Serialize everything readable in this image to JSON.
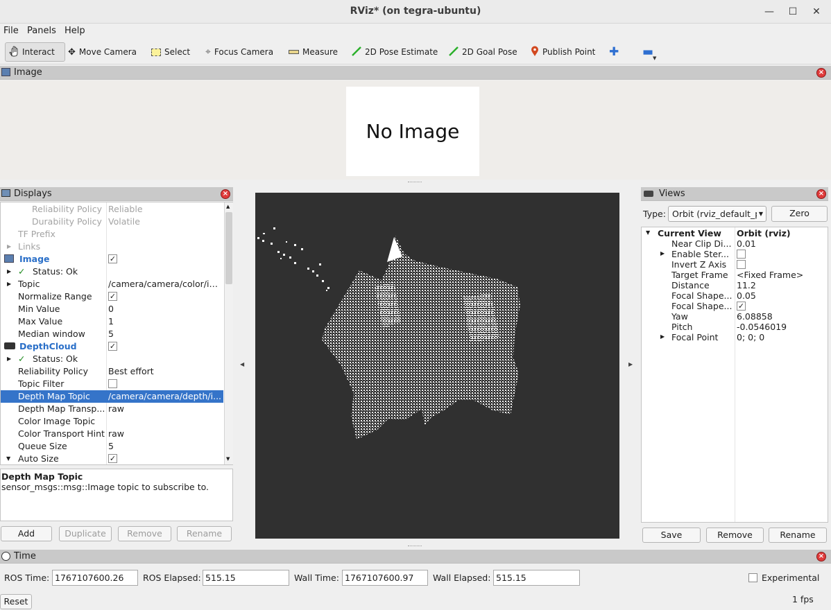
{
  "window": {
    "title": "RViz* (on tegra-ubuntu)"
  },
  "menu": [
    "File",
    "Panels",
    "Help"
  ],
  "toolbar": {
    "interact": "Interact",
    "move_camera": "Move Camera",
    "select": "Select",
    "focus_camera": "Focus Camera",
    "measure": "Measure",
    "pose_estimate": "2D Pose Estimate",
    "goal_pose": "2D Goal Pose",
    "publish_point": "Publish Point"
  },
  "image_panel": {
    "title": "Image",
    "placeholder": "No Image"
  },
  "displays": {
    "title": "Displays",
    "rows": [
      {
        "key": "Reliability Policy",
        "value": "Reliable"
      },
      {
        "key": "Durability Policy",
        "value": "Volatile"
      },
      {
        "key": "TF Prefix",
        "value": ""
      },
      {
        "key": "Links",
        "value": ""
      },
      {
        "key": "Image",
        "value": ""
      },
      {
        "key": "Status: Ok",
        "value": ""
      },
      {
        "key": "Topic",
        "value": "/camera/camera/color/im..."
      },
      {
        "key": "Normalize Range",
        "value": ""
      },
      {
        "key": "Min Value",
        "value": "0"
      },
      {
        "key": "Max Value",
        "value": "1"
      },
      {
        "key": "Median window",
        "value": "5"
      },
      {
        "key": "DepthCloud",
        "value": ""
      },
      {
        "key": "Status: Ok",
        "value": ""
      },
      {
        "key": "Reliability Policy",
        "value": "Best effort"
      },
      {
        "key": "Topic Filter",
        "value": ""
      },
      {
        "key": "Depth Map Topic",
        "value": "/camera/camera/depth/i..."
      },
      {
        "key": "Depth Map Transp...",
        "value": "raw"
      },
      {
        "key": "Color Image Topic",
        "value": ""
      },
      {
        "key": "Color Transport Hint",
        "value": "raw"
      },
      {
        "key": "Queue Size",
        "value": "5"
      },
      {
        "key": "Auto Size",
        "value": ""
      }
    ],
    "help_title": "Depth Map Topic",
    "help_text": "sensor_msgs::msg::Image topic to subscribe to.",
    "buttons": {
      "add": "Add",
      "duplicate": "Duplicate",
      "remove": "Remove",
      "rename": "Rename"
    }
  },
  "views": {
    "title": "Views",
    "type_label": "Type:",
    "type_value": "Orbit (rviz_default_p",
    "zero": "Zero",
    "rows": [
      {
        "key": "Current View",
        "value": "Orbit (rviz)"
      },
      {
        "key": "Near Clip Di...",
        "value": "0.01"
      },
      {
        "key": "Enable Ster...",
        "value": ""
      },
      {
        "key": "Invert Z Axis",
        "value": ""
      },
      {
        "key": "Target Frame",
        "value": "<Fixed Frame>"
      },
      {
        "key": "Distance",
        "value": "11.2"
      },
      {
        "key": "Focal Shape...",
        "value": "0.05"
      },
      {
        "key": "Focal Shape...",
        "value": ""
      },
      {
        "key": "Yaw",
        "value": "6.08858"
      },
      {
        "key": "Pitch",
        "value": "-0.0546019"
      },
      {
        "key": "Focal Point",
        "value": "0; 0; 0"
      }
    ],
    "buttons": {
      "save": "Save",
      "remove": "Remove",
      "rename": "Rename"
    }
  },
  "time": {
    "title": "Time",
    "ros_time_label": "ROS Time:",
    "ros_time": "1767107600.26",
    "ros_elapsed_label": "ROS Elapsed:",
    "ros_elapsed": "515.15",
    "wall_time_label": "Wall Time:",
    "wall_time": "1767107600.97",
    "wall_elapsed_label": "Wall Elapsed:",
    "wall_elapsed": "515.15",
    "experimental": "Experimental",
    "reset": "Reset",
    "fps": "1 fps"
  },
  "colors": {
    "selection": "#3574c9",
    "panel_header": "#c9c9c9",
    "viewport": "#303030"
  }
}
